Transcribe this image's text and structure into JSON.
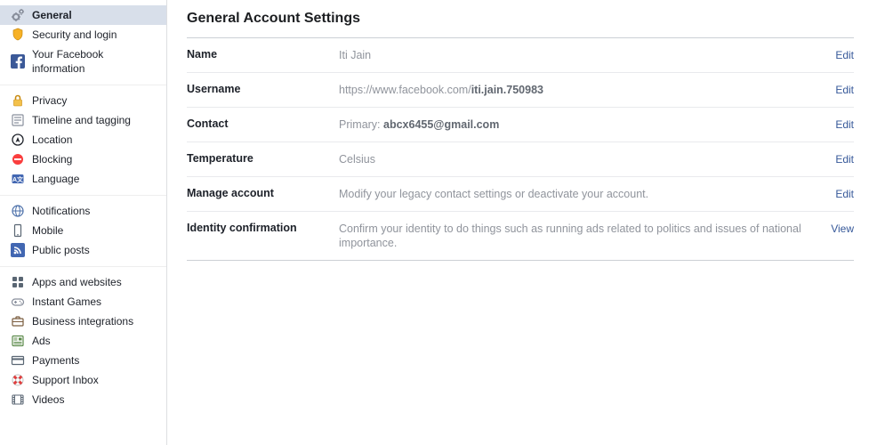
{
  "page_title": "General Account Settings",
  "nav": {
    "groups": [
      [
        {
          "key": "general",
          "label": "General",
          "active": true
        },
        {
          "key": "security",
          "label": "Security and login"
        },
        {
          "key": "yourinfo",
          "label": "Your Facebook information"
        }
      ],
      [
        {
          "key": "privacy",
          "label": "Privacy"
        },
        {
          "key": "timeline",
          "label": "Timeline and tagging"
        },
        {
          "key": "location",
          "label": "Location"
        },
        {
          "key": "blocking",
          "label": "Blocking"
        },
        {
          "key": "language",
          "label": "Language"
        }
      ],
      [
        {
          "key": "notifications",
          "label": "Notifications"
        },
        {
          "key": "mobile",
          "label": "Mobile"
        },
        {
          "key": "publicposts",
          "label": "Public posts"
        }
      ],
      [
        {
          "key": "apps",
          "label": "Apps and websites"
        },
        {
          "key": "instantgames",
          "label": "Instant Games"
        },
        {
          "key": "bizint",
          "label": "Business integrations"
        },
        {
          "key": "ads",
          "label": "Ads"
        },
        {
          "key": "payments",
          "label": "Payments"
        },
        {
          "key": "support",
          "label": "Support Inbox"
        },
        {
          "key": "videos",
          "label": "Videos"
        }
      ]
    ]
  },
  "rows": {
    "name": {
      "label": "Name",
      "value": "Iti Jain",
      "action": "Edit"
    },
    "username": {
      "label": "Username",
      "prefix": "https://www.facebook.com/",
      "slug": "iti.jain.750983",
      "action": "Edit"
    },
    "contact": {
      "label": "Contact",
      "primary_label": "Primary: ",
      "email": "abcx6455@gmail.com",
      "action": "Edit"
    },
    "temp": {
      "label": "Temperature",
      "value": "Celsius",
      "action": "Edit"
    },
    "manage": {
      "label": "Manage account",
      "value": "Modify your legacy contact settings or deactivate your account.",
      "action": "Edit"
    },
    "identity": {
      "label": "Identity confirmation",
      "value": "Confirm your identity to do things such as running ads related to politics and issues of national importance.",
      "action": "View"
    }
  }
}
